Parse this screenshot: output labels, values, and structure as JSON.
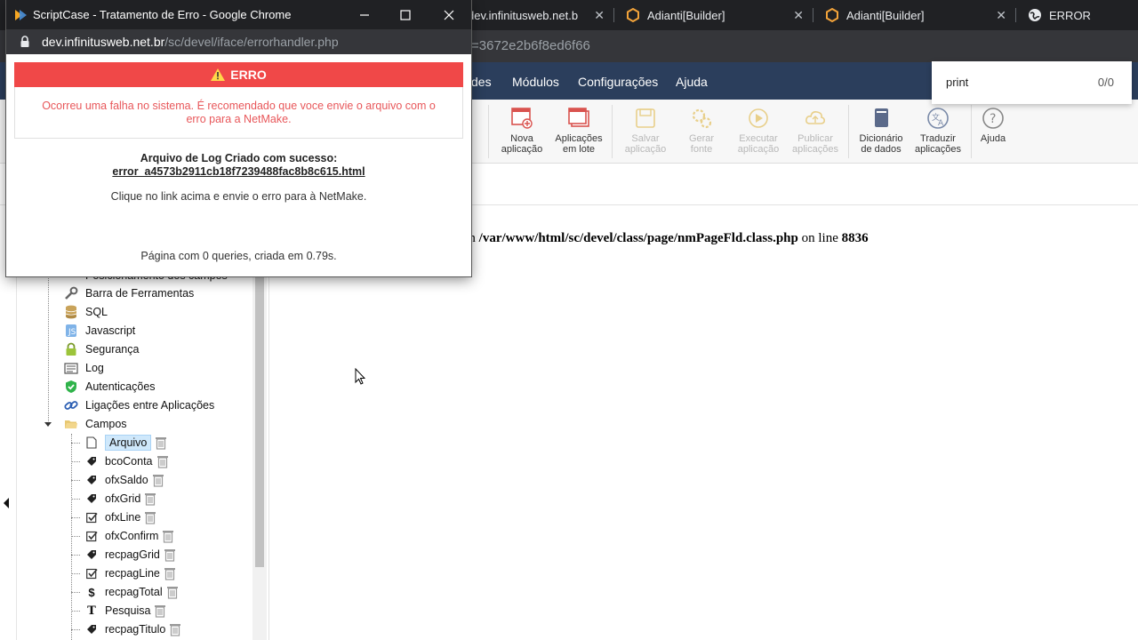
{
  "popup": {
    "window_title": "ScriptCase - Tratamento de Erro - Google Chrome",
    "url_host": "dev.infinitusweb.net.br",
    "url_path": "/sc/devel/iface/errorhandler.php",
    "error_title": "ERRO",
    "error_message": "Ocorreu uma falha no sistema. É recomendado que voce envie o arquivo com o erro para a NetMake.",
    "log_created": "Arquivo de Log Criado com sucesso:",
    "log_file": "error_a4573b2911cb18f7239488fac8b8c615.html",
    "hint": "Clique no link acima e envie o erro para à NetMake.",
    "queries": "Página com 0 queries, criada em 0.79s."
  },
  "browser": {
    "tabs": [
      {
        "label": "dev.infinitusweb.net.b"
      },
      {
        "label": "Adianti[Builder]"
      },
      {
        "label": "Adianti[Builder]"
      },
      {
        "label": "ERROR"
      }
    ],
    "url_fragment": "=3672e2b6f8ed6f66"
  },
  "menu": {
    "items": [
      "des",
      "Módulos",
      "Configurações",
      "Ajuda"
    ]
  },
  "toolbar": {
    "buttons": [
      {
        "label1": "Nova",
        "label2": "aplicação"
      },
      {
        "label1": "Aplicações",
        "label2": "em lote"
      },
      {
        "label1": "Salvar",
        "label2": "aplicação"
      },
      {
        "label1": "Gerar",
        "label2": "fonte"
      },
      {
        "label1": "Executar",
        "label2": "aplicação"
      },
      {
        "label1": "Publicar",
        "label2": "aplicações"
      },
      {
        "label1": "Dicionário",
        "label2": "de dados"
      },
      {
        "label1": "Traduzir",
        "label2": "aplicações"
      },
      {
        "label1": "Ajuda",
        "label2": ""
      }
    ]
  },
  "find": {
    "query": "print",
    "count": "0/0"
  },
  "main": {
    "msg_prefix": "d in ",
    "msg_path": "/var/www/html/sc/devel/class/page/nmPageFld.class.php",
    "msg_mid": " on line ",
    "msg_line": "8836"
  },
  "tree": {
    "partial_item": "Posicionamento dos campos",
    "items": [
      "Barra de Ferramentas",
      "SQL",
      "Javascript",
      "Segurança",
      "Log",
      "Autenticações",
      "Ligações entre Aplicações",
      "Campos"
    ],
    "fields": [
      "Arquivo",
      "bcoConta",
      "ofxSaldo",
      "ofxGrid",
      "ofxLine",
      "ofxConfirm",
      "recpagGrid",
      "recpagLine",
      "recpagTotal",
      "Pesquisa",
      "recpagTitulo"
    ]
  }
}
